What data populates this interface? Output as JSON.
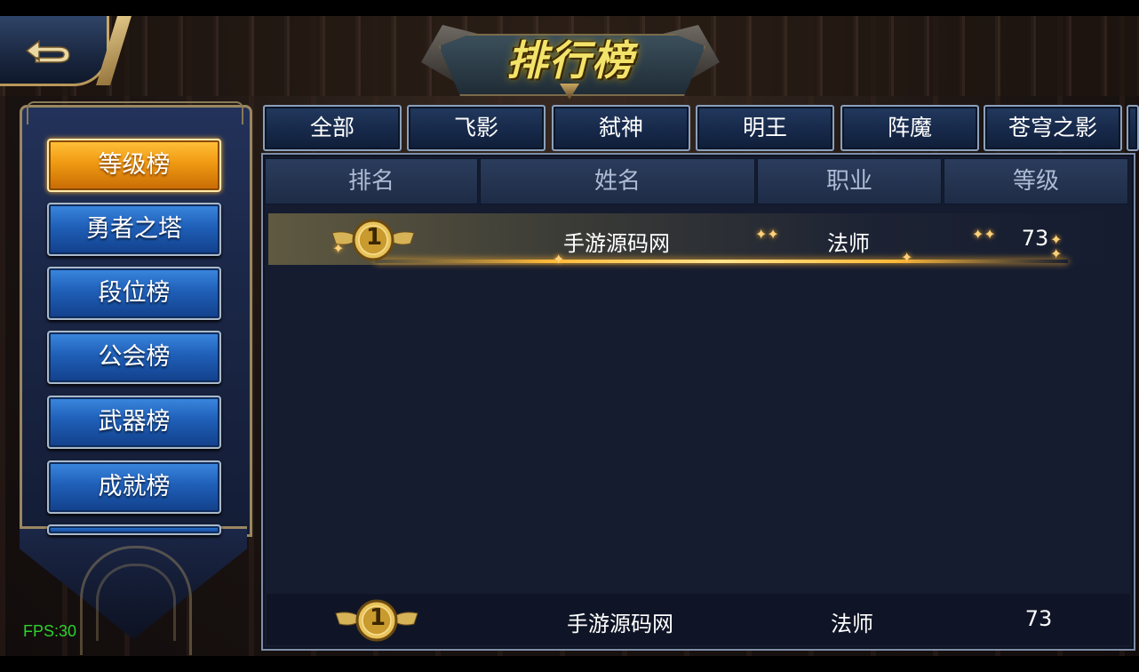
{
  "header": {
    "title": "排行榜"
  },
  "sidebar": {
    "items": [
      {
        "label": "等级榜",
        "active": true
      },
      {
        "label": "勇者之塔",
        "active": false
      },
      {
        "label": "段位榜",
        "active": false
      },
      {
        "label": "公会榜",
        "active": false
      },
      {
        "label": "武器榜",
        "active": false
      },
      {
        "label": "成就榜",
        "active": false
      }
    ]
  },
  "tabs": [
    {
      "label": "全部"
    },
    {
      "label": "飞影"
    },
    {
      "label": "弑神"
    },
    {
      "label": "明王"
    },
    {
      "label": "阵魔"
    },
    {
      "label": "苍穹之影"
    }
  ],
  "table": {
    "columns": [
      "排名",
      "姓名",
      "职业",
      "等级"
    ],
    "rows": [
      {
        "rank": "1",
        "name": "手游源码网",
        "class": "法师",
        "level": "73"
      }
    ]
  },
  "my_rank": {
    "rank": "1",
    "name": "手游源码网",
    "class": "法师",
    "level": "73"
  },
  "debug": {
    "fps": "FPS:30"
  },
  "colors": {
    "active_button": "#f09a12",
    "button_blue": "#1f5fb8",
    "gold_accent": "#ffb93a",
    "fps_green": "#2cd32c"
  }
}
